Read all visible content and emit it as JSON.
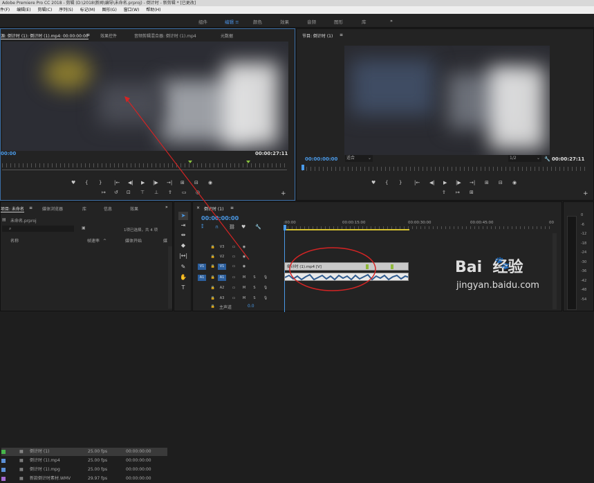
{
  "titlebar": {
    "title": "Adobe Premiere Pro CC 2018 - 剪辑 (D:\\2018\\新闻\\编导\\未命名.prproj) - 倒计时 - 新剪辑 * [已更改]"
  },
  "menu": [
    "件(F)",
    "编辑(E)",
    "剪辑(C)",
    "序列(S)",
    "标记(M)",
    "图形(G)",
    "窗口(W)",
    "帮助(H)"
  ],
  "workspaces": {
    "items": [
      "组件",
      "编辑",
      "颜色",
      "效果",
      "音频",
      "图形",
      "库"
    ],
    "active": 1,
    "more": "»"
  },
  "source_panel": {
    "tabs": [
      "源: 倒计时 (1): 倒计时 (1).mp4: 00:00:00:00",
      "效果控件",
      "音频剪辑混合器: 倒计时 (1).mp4",
      "元数据"
    ],
    "timecode_left": "00:00",
    "timecode_right": "00:00:27:11"
  },
  "program_panel": {
    "tab": "节目: 倒计时 (1)",
    "timecode_left": "00:00:00:00",
    "fit": "适合",
    "quality": "1/2",
    "timecode_right": "00:00:27:11"
  },
  "project_panel": {
    "tabs": [
      "项目: 未命名",
      "媒体浏览器",
      "库",
      "信息",
      "效果"
    ],
    "file": "未命名.prproj",
    "selection_info": "1项已选择，共 4 项",
    "columns": [
      "名称",
      "帧速率",
      "媒体开始",
      "媒"
    ],
    "rows": [
      {
        "name": "倒计时 (1)",
        "fps": "25.00 fps",
        "start": "00:00:00:00",
        "color": "#47b54a",
        "type": "sequence-icon"
      },
      {
        "name": "倒计时 (1).mp4",
        "fps": "25.00 fps",
        "start": "00:00:00:00",
        "color": "#5b8fd6",
        "type": "video-clip-icon"
      },
      {
        "name": "倒计时 (1).mpg",
        "fps": "25.00 fps",
        "start": "00:00:00:00",
        "color": "#5b8fd6",
        "type": "video-clip-icon"
      },
      {
        "name": "新款倒计时素材.WMV",
        "fps": "29.97 fps",
        "start": "00:00:00:00",
        "color": "#a56bd1",
        "type": "video-clip-icon"
      }
    ]
  },
  "timeline": {
    "tab": "倒计时 (1)",
    "timecode": "00:00:00:00",
    "ruler": [
      ":00:00",
      "00:00:15:00",
      "00:00:30:00",
      "00:00:45:00",
      "00"
    ],
    "tracks": [
      {
        "label": "V3",
        "kind": "video"
      },
      {
        "label": "V2",
        "kind": "video"
      },
      {
        "label": "V1",
        "kind": "video",
        "src": "V1"
      },
      {
        "label": "A1",
        "kind": "audio",
        "src": "A1"
      },
      {
        "label": "A2",
        "kind": "audio"
      },
      {
        "label": "A3",
        "kind": "audio"
      }
    ],
    "master": {
      "label": "主声道",
      "value": "0.0"
    },
    "video_clip": "倒计时 (1).mp4 [V]",
    "track_btns": {
      "m": "M",
      "s": "S"
    }
  },
  "meter": [
    "0",
    "-6",
    "-12",
    "-18",
    "-24",
    "-30",
    "-36",
    "-42",
    "-48",
    "-54"
  ],
  "watermark": {
    "brand": "Bai  经验",
    "url": "jingyan.baidu.com"
  },
  "colors": {
    "accent": "#4a90e2",
    "annotation": "#d42424",
    "selected_track": "#2c5f9e"
  }
}
